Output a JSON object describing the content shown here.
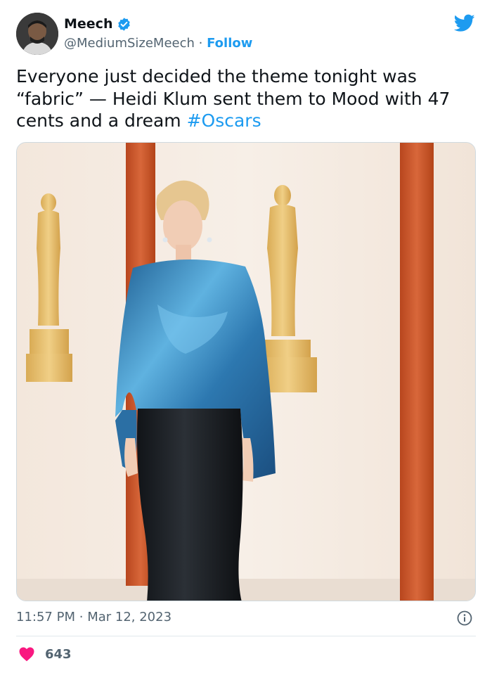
{
  "author": {
    "display_name": "Meech",
    "handle": "@MediumSizeMeech",
    "separator": "·",
    "follow_label": "Follow"
  },
  "tweet": {
    "text": "Everyone just decided the theme tonight was “fabric” — Heidi Klum sent them to Mood with 47 cents and a dream ",
    "hashtag": "#Oscars"
  },
  "meta": {
    "time": "11:57 PM",
    "separator": "·",
    "date": "Mar 12, 2023"
  },
  "engagement": {
    "likes": "643"
  },
  "colors": {
    "accent": "#1d9bf0",
    "heart": "#f91880",
    "secondary_text": "#536471",
    "pillar": "#c9562a",
    "statue": "#e6c174",
    "blouse": "#3f8fc4"
  },
  "icons": [
    "verified-badge-icon",
    "twitter-bird-icon",
    "info-icon",
    "heart-icon"
  ]
}
